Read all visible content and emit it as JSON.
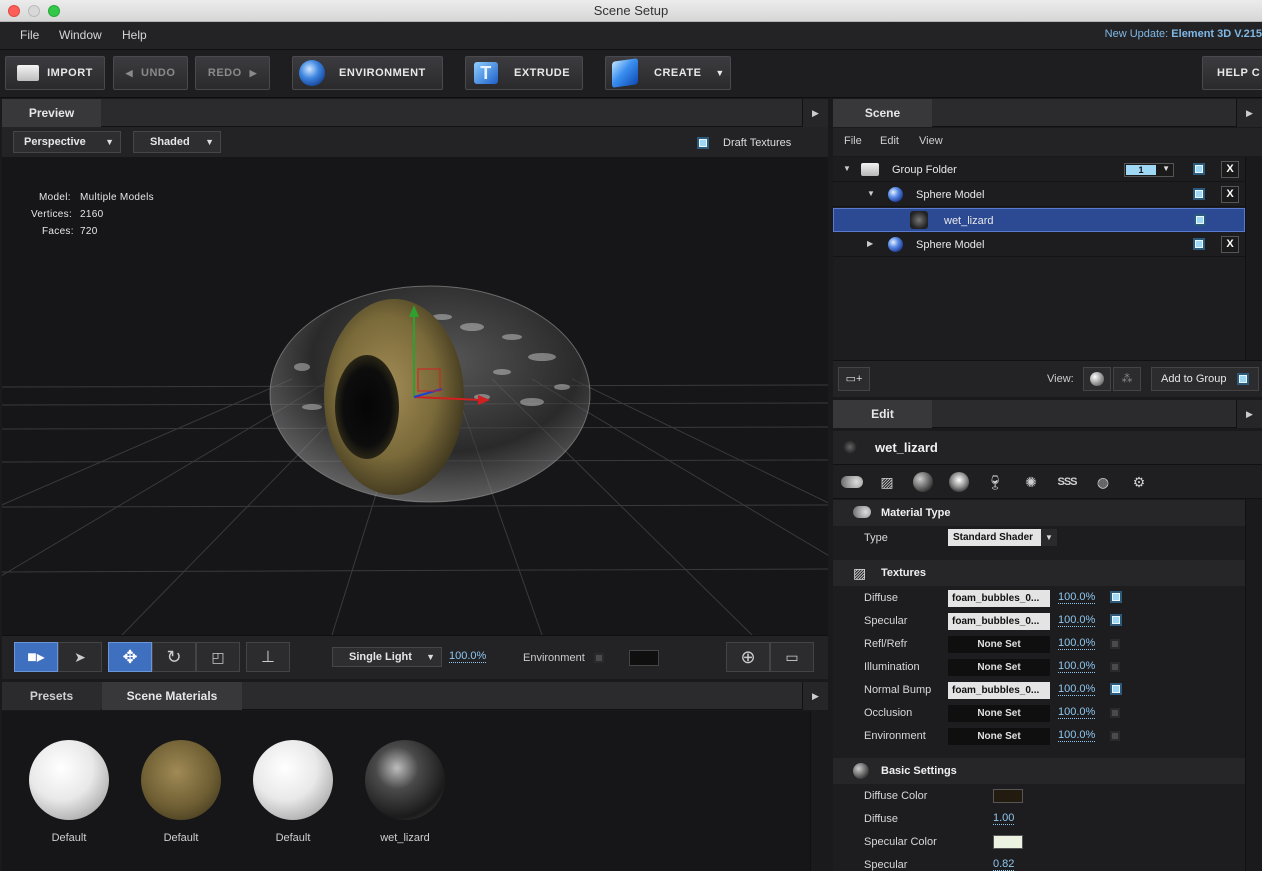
{
  "window": {
    "title": "Scene Setup"
  },
  "menu": {
    "file": "File",
    "window": "Window",
    "help": "Help"
  },
  "update": {
    "prefix": "New Update:",
    "text": "Element 3D V.215"
  },
  "toolbar": {
    "import": "IMPORT",
    "undo": "UNDO",
    "redo": "REDO",
    "environment": "ENVIRONMENT",
    "extrude": "EXTRUDE",
    "create": "CREATE",
    "help": "HELP C"
  },
  "preview": {
    "tab": "Preview",
    "camera_mode": "Perspective",
    "shading_mode": "Shaded",
    "draft_textures_label": "Draft Textures",
    "draft_textures_checked": true,
    "stats": {
      "model_label": "Model:",
      "model_value": "Multiple Models",
      "vertices_label": "Vertices:",
      "vertices_value": "2160",
      "faces_label": "Faces:",
      "faces_value": "720"
    }
  },
  "viewport_tools": {
    "light_mode": "Single Light",
    "light_pct": "100.0%",
    "environment_label": "Environment"
  },
  "presets": {
    "tabs": [
      "Presets",
      "Scene Materials"
    ],
    "materials": [
      {
        "name": "Default",
        "kind": "white"
      },
      {
        "name": "Default",
        "kind": "lizard-eye"
      },
      {
        "name": "Default",
        "kind": "white"
      },
      {
        "name": "wet_lizard",
        "kind": "dark-wet"
      }
    ]
  },
  "scene": {
    "tab": "Scene",
    "menu": [
      "File",
      "Edit",
      "View"
    ],
    "tree": [
      {
        "label": "Group Folder",
        "group_index": "1"
      },
      {
        "label": "Sphere Model"
      },
      {
        "label": "wet_lizard"
      },
      {
        "label": "Sphere Model"
      }
    ],
    "view_label": "View:",
    "add_to_group": "Add to Group"
  },
  "edit": {
    "tab": "Edit",
    "material_name": "wet_lizard",
    "material_type": {
      "title": "Material Type",
      "type_label": "Type",
      "type_value": "Standard Shader"
    },
    "textures": {
      "title": "Textures",
      "rows": [
        {
          "label": "Diffuse",
          "value": "foam_bubbles_0...",
          "pct": "100.0%",
          "on": true
        },
        {
          "label": "Specular",
          "value": "foam_bubbles_0...",
          "pct": "100.0%",
          "on": true
        },
        {
          "label": "Refl/Refr",
          "value": "None Set",
          "pct": "100.0%",
          "on": false
        },
        {
          "label": "Illumination",
          "value": "None Set",
          "pct": "100.0%",
          "on": false
        },
        {
          "label": "Normal Bump",
          "value": "foam_bubbles_0...",
          "pct": "100.0%",
          "on": true
        },
        {
          "label": "Occlusion",
          "value": "None Set",
          "pct": "100.0%",
          "on": false
        },
        {
          "label": "Environment",
          "value": "None Set",
          "pct": "100.0%",
          "on": false
        }
      ]
    },
    "basic": {
      "title": "Basic Settings",
      "diffuse_color_label": "Diffuse Color",
      "diffuse_color": "#231a10",
      "diffuse_label": "Diffuse",
      "diffuse_value": "1.00",
      "specular_color_label": "Specular Color",
      "specular_color": "#ecf2e2",
      "specular_label": "Specular",
      "specular_value": "0.82"
    }
  }
}
